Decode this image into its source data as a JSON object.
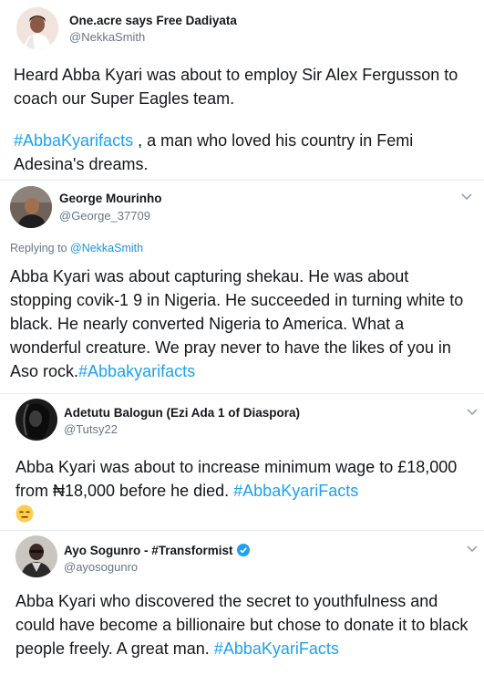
{
  "tweets": [
    {
      "name": "One.acre says Free Dadiyata",
      "handle": "@NekkaSmith",
      "text_1": "Heard Abba Kyari was about to employ Sir Alex Fergusson to coach our Super Eagles team.",
      "hashtag": "#AbbaKyarifacts",
      "text_2": " , a man who loved his country in Femi Adesina's dreams."
    },
    {
      "name": "George Mourinho",
      "handle": "@George_37709",
      "reply_prefix": "Replying to ",
      "reply_to": "@NekkaSmith",
      "text": "Abba Kyari was about capturing shekau. He was about stopping covik-1 9 in Nigeria. He succeeded in turning white to black.  He nearly converted Nigeria to America. What a wonderful creature. We pray never to have the likes of you in Aso rock.",
      "hashtag": "#Abbakyarifacts"
    },
    {
      "name": "Adetutu Balogun (Ezi Ada 1 of Diaspora)",
      "handle": "@Tutsy22",
      "text": "Abba Kyari was about to increase minimum wage to £18,000 from ₦18,000 before he died. ",
      "hashtag": "#AbbaKyariFacts",
      "emoji": "expressionless-face-emoji"
    },
    {
      "name": "Ayo Sogunro - #Transformist",
      "handle": "@ayosogunro",
      "badge": "verified-badge-icon",
      "text": "Abba Kyari who discovered the secret to youthfulness and could have become a billionaire but chose to donate it to black people freely. A great man.",
      "hashtag": "#AbbaKyariFacts"
    }
  ],
  "icons": {
    "menu": "chevron-down-icon"
  },
  "colors": {
    "link": "#1da1f2",
    "muted": "#657786",
    "text": "#14171a",
    "verified": "#1da1f2"
  }
}
